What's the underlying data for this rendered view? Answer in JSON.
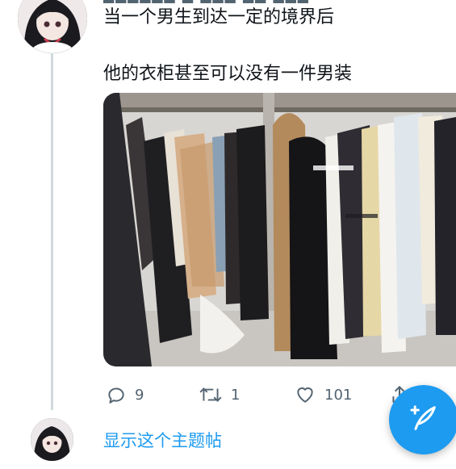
{
  "tweet": {
    "line1": "当一个男生到达一定的境界后",
    "line2": "他的衣柜甚至可以没有一件男装",
    "photo_icon": "wardrobe-photo"
  },
  "actions": {
    "reply_count": "9",
    "retweet_count": "1",
    "like_count": "101",
    "reply_icon": "reply-icon",
    "retweet_icon": "retweet-icon",
    "like_icon": "heart-icon",
    "share_icon": "share-icon"
  },
  "thread": {
    "show_label": "显示这个主题帖"
  },
  "fab": {
    "icon": "compose-icon"
  },
  "colors": {
    "accent": "#1d9bf0",
    "secondary_text": "#536471",
    "thread_line": "#cfd9de"
  }
}
